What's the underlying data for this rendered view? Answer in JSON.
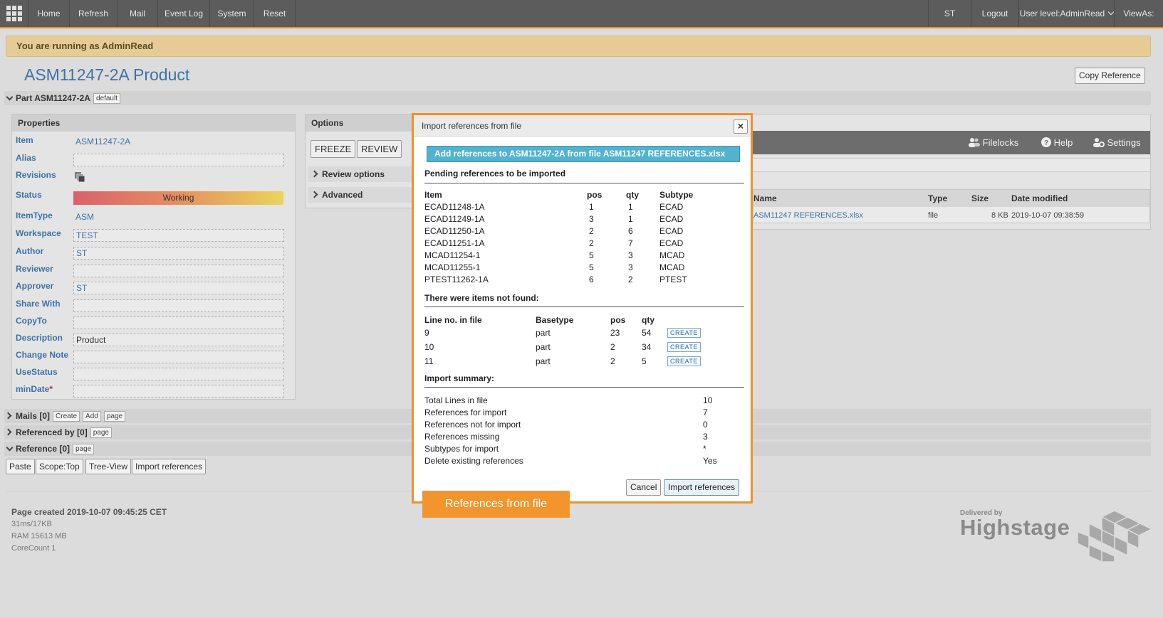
{
  "nav": {
    "items": [
      "Home",
      "Refresh",
      "Mail",
      "Event Log",
      "System",
      "Reset"
    ],
    "user_initials": "ST",
    "logout": "Logout",
    "user_level": "User level:AdminRead",
    "view_as": "ViewAs:"
  },
  "banner": "You are running as AdminRead",
  "page": {
    "title": "ASM11247-2A Product",
    "copy_reference": "Copy Reference"
  },
  "part_section": {
    "label": "Part ASM11247-2A",
    "badge": "default"
  },
  "properties": {
    "header": "Properties",
    "rows": [
      {
        "label": "Item",
        "value": "ASM11247-2A"
      },
      {
        "label": "Alias",
        "value": ""
      },
      {
        "label": "Revisions",
        "value": ""
      },
      {
        "label": "Status",
        "value": "Working"
      },
      {
        "label": "ItemType",
        "value": "ASM"
      },
      {
        "label": "Workspace",
        "value": "TEST"
      },
      {
        "label": "Author",
        "value": "ST"
      },
      {
        "label": "Reviewer",
        "value": ""
      },
      {
        "label": "Approver",
        "value": "ST"
      },
      {
        "label": "Share With",
        "value": ""
      },
      {
        "label": "CopyTo",
        "value": ""
      },
      {
        "label": "Description",
        "value": "Product"
      },
      {
        "label": "Change Note",
        "value": ""
      },
      {
        "label": "UseStatus",
        "value": ""
      },
      {
        "label": "minDate",
        "value": "",
        "required_mark": "*"
      }
    ]
  },
  "options": {
    "header": "Options",
    "buttons": [
      "FREEZE",
      "REVIEW"
    ],
    "review_options": "Review options",
    "advanced": "Advanced"
  },
  "toolbar": {
    "filelocks": "Filelocks",
    "help": "Help",
    "settings": "Settings"
  },
  "files": {
    "columns": [
      "Name",
      "Type",
      "Size",
      "Date modified"
    ],
    "rows": [
      {
        "name": "ASM11247 REFERENCES.xlsx",
        "type": "file",
        "size": "8 KB",
        "date": "2019-10-07 09:38:59"
      }
    ]
  },
  "sections": {
    "mails": {
      "label": "Mails [0]",
      "buttons": [
        "Create",
        "Add",
        "page"
      ]
    },
    "referenced_by": {
      "label": "Referenced by [0]",
      "buttons": [
        "page"
      ]
    },
    "reference": {
      "label": "Reference [0]",
      "buttons": [
        "page"
      ]
    }
  },
  "reference_buttons": [
    "Paste",
    "Scope:Top",
    "Tree-View",
    "Import references"
  ],
  "footer": {
    "created": "Page created 2019-10-07 09:45:25 CET",
    "timing": "31ms/17KB",
    "ram": "RAM 15613 MB",
    "cores": "CoreCount 1",
    "logo_small": "Delivered by",
    "logo_big": "Highstage"
  },
  "modal": {
    "title": "Import references from file",
    "close": "×",
    "add_bar": "Add references to ASM11247-2A from file ASM11247 REFERENCES.xlsx",
    "pending_heading": "Pending references to be imported",
    "pending_columns": [
      "Item",
      "pos",
      "qty",
      "Subtype"
    ],
    "pending_rows": [
      [
        "ECAD11248-1A",
        "1",
        "1",
        "ECAD"
      ],
      [
        "ECAD11249-1A",
        "3",
        "1",
        "ECAD"
      ],
      [
        "ECAD11250-1A",
        "2",
        "6",
        "ECAD"
      ],
      [
        "ECAD11251-1A",
        "2",
        "7",
        "ECAD"
      ],
      [
        "MCAD11254-1",
        "5",
        "3",
        "MCAD"
      ],
      [
        "MCAD11255-1",
        "5",
        "3",
        "MCAD"
      ],
      [
        "PTEST11262-1A",
        "6",
        "2",
        "PTEST"
      ]
    ],
    "missing_heading": "There were items not found:",
    "missing_columns": [
      "Line no. in file",
      "Basetype",
      "pos",
      "qty"
    ],
    "missing_rows": [
      [
        "9",
        "part",
        "23",
        "54"
      ],
      [
        "10",
        "part",
        "2",
        "34"
      ],
      [
        "11",
        "part",
        "2",
        "5"
      ]
    ],
    "create_label": "CREATE",
    "summary_heading": "Import summary:",
    "summary_rows": [
      [
        "Total Lines in file",
        "10"
      ],
      [
        "References for import",
        "7"
      ],
      [
        "References not for import",
        "0"
      ],
      [
        "References missing",
        "3"
      ],
      [
        "Subtypes for import",
        "*"
      ],
      [
        "Delete existing references",
        "Yes"
      ]
    ],
    "cancel": "Cancel",
    "import": "Import references"
  },
  "tooltip": "References from file"
}
